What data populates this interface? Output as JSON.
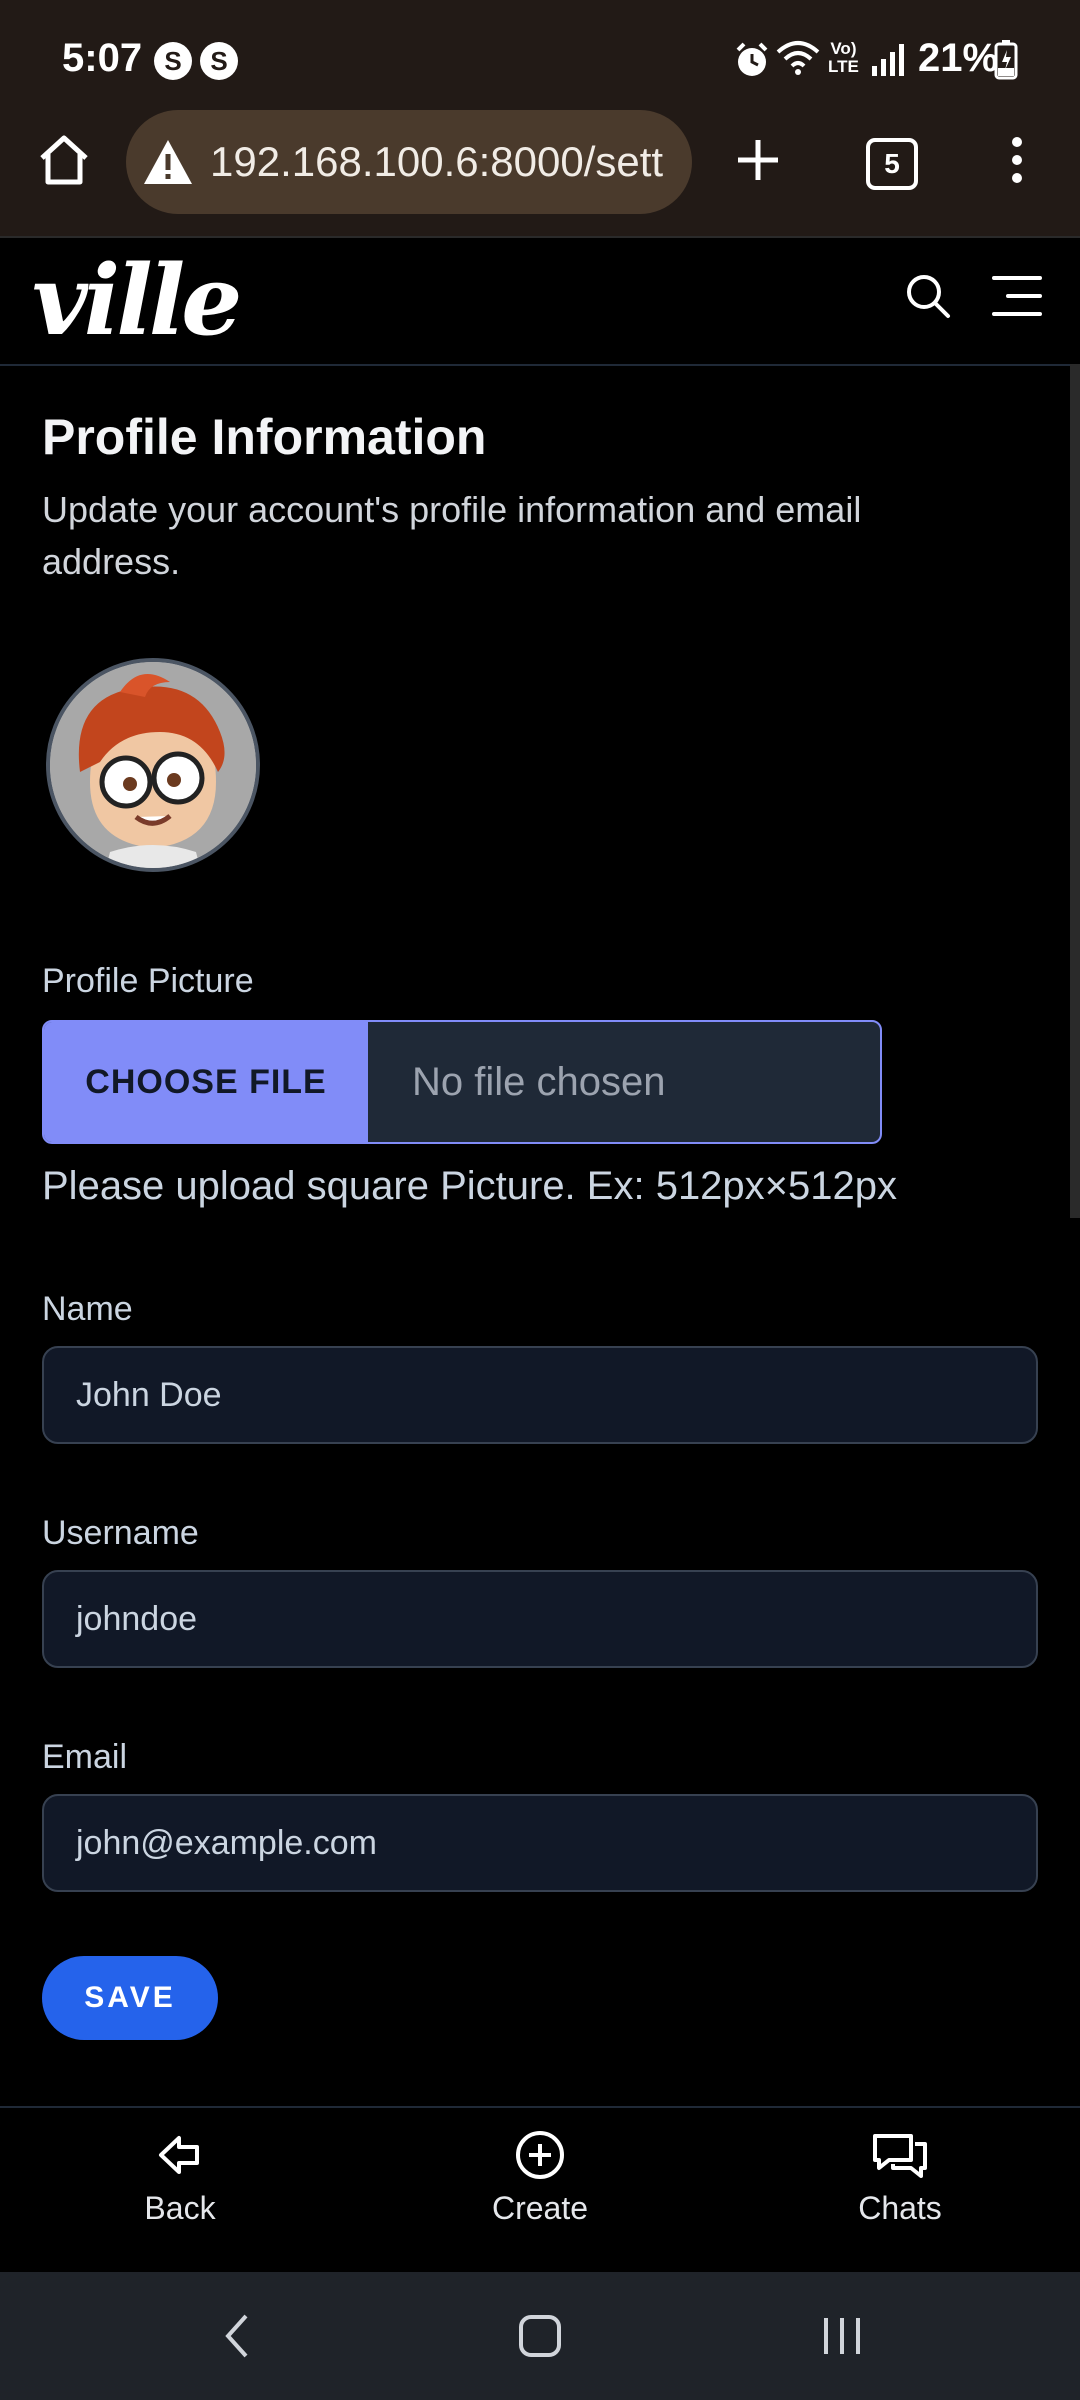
{
  "status_bar": {
    "time": "5:07",
    "notification_badges": [
      "S",
      "S"
    ],
    "battery": "21%",
    "icons": [
      "alarm-icon",
      "wifi-icon",
      "volte-icon",
      "signal-icon",
      "battery-charging-icon"
    ]
  },
  "browser": {
    "url": "192.168.100.6:8000/sett",
    "tab_count": "5",
    "icons": [
      "home-icon",
      "not-secure-warning-icon",
      "new-tab-plus-icon",
      "more-vert-icon"
    ]
  },
  "app": {
    "logo": "ville",
    "icons": [
      "search-icon",
      "hamburger-menu-icon"
    ]
  },
  "profile": {
    "title": "Profile Information",
    "subtitle": "Update your account's profile information and email address.",
    "picture_label": "Profile Picture",
    "choose_file": "CHOOSE FILE",
    "file_status": "No file chosen",
    "file_hint": "Please upload square Picture. Ex: 512px×512px",
    "name_label": "Name",
    "name_value": "John Doe",
    "username_label": "Username",
    "username_value": "johndoe",
    "email_label": "Email",
    "email_value": "john@example.com",
    "save": "SAVE"
  },
  "bottom_nav": {
    "back": "Back",
    "create": "Create",
    "chats": "Chats"
  },
  "colors": {
    "accent": "#818cf8",
    "primary_button": "#2563eb",
    "browser_bar": "#221a16"
  }
}
